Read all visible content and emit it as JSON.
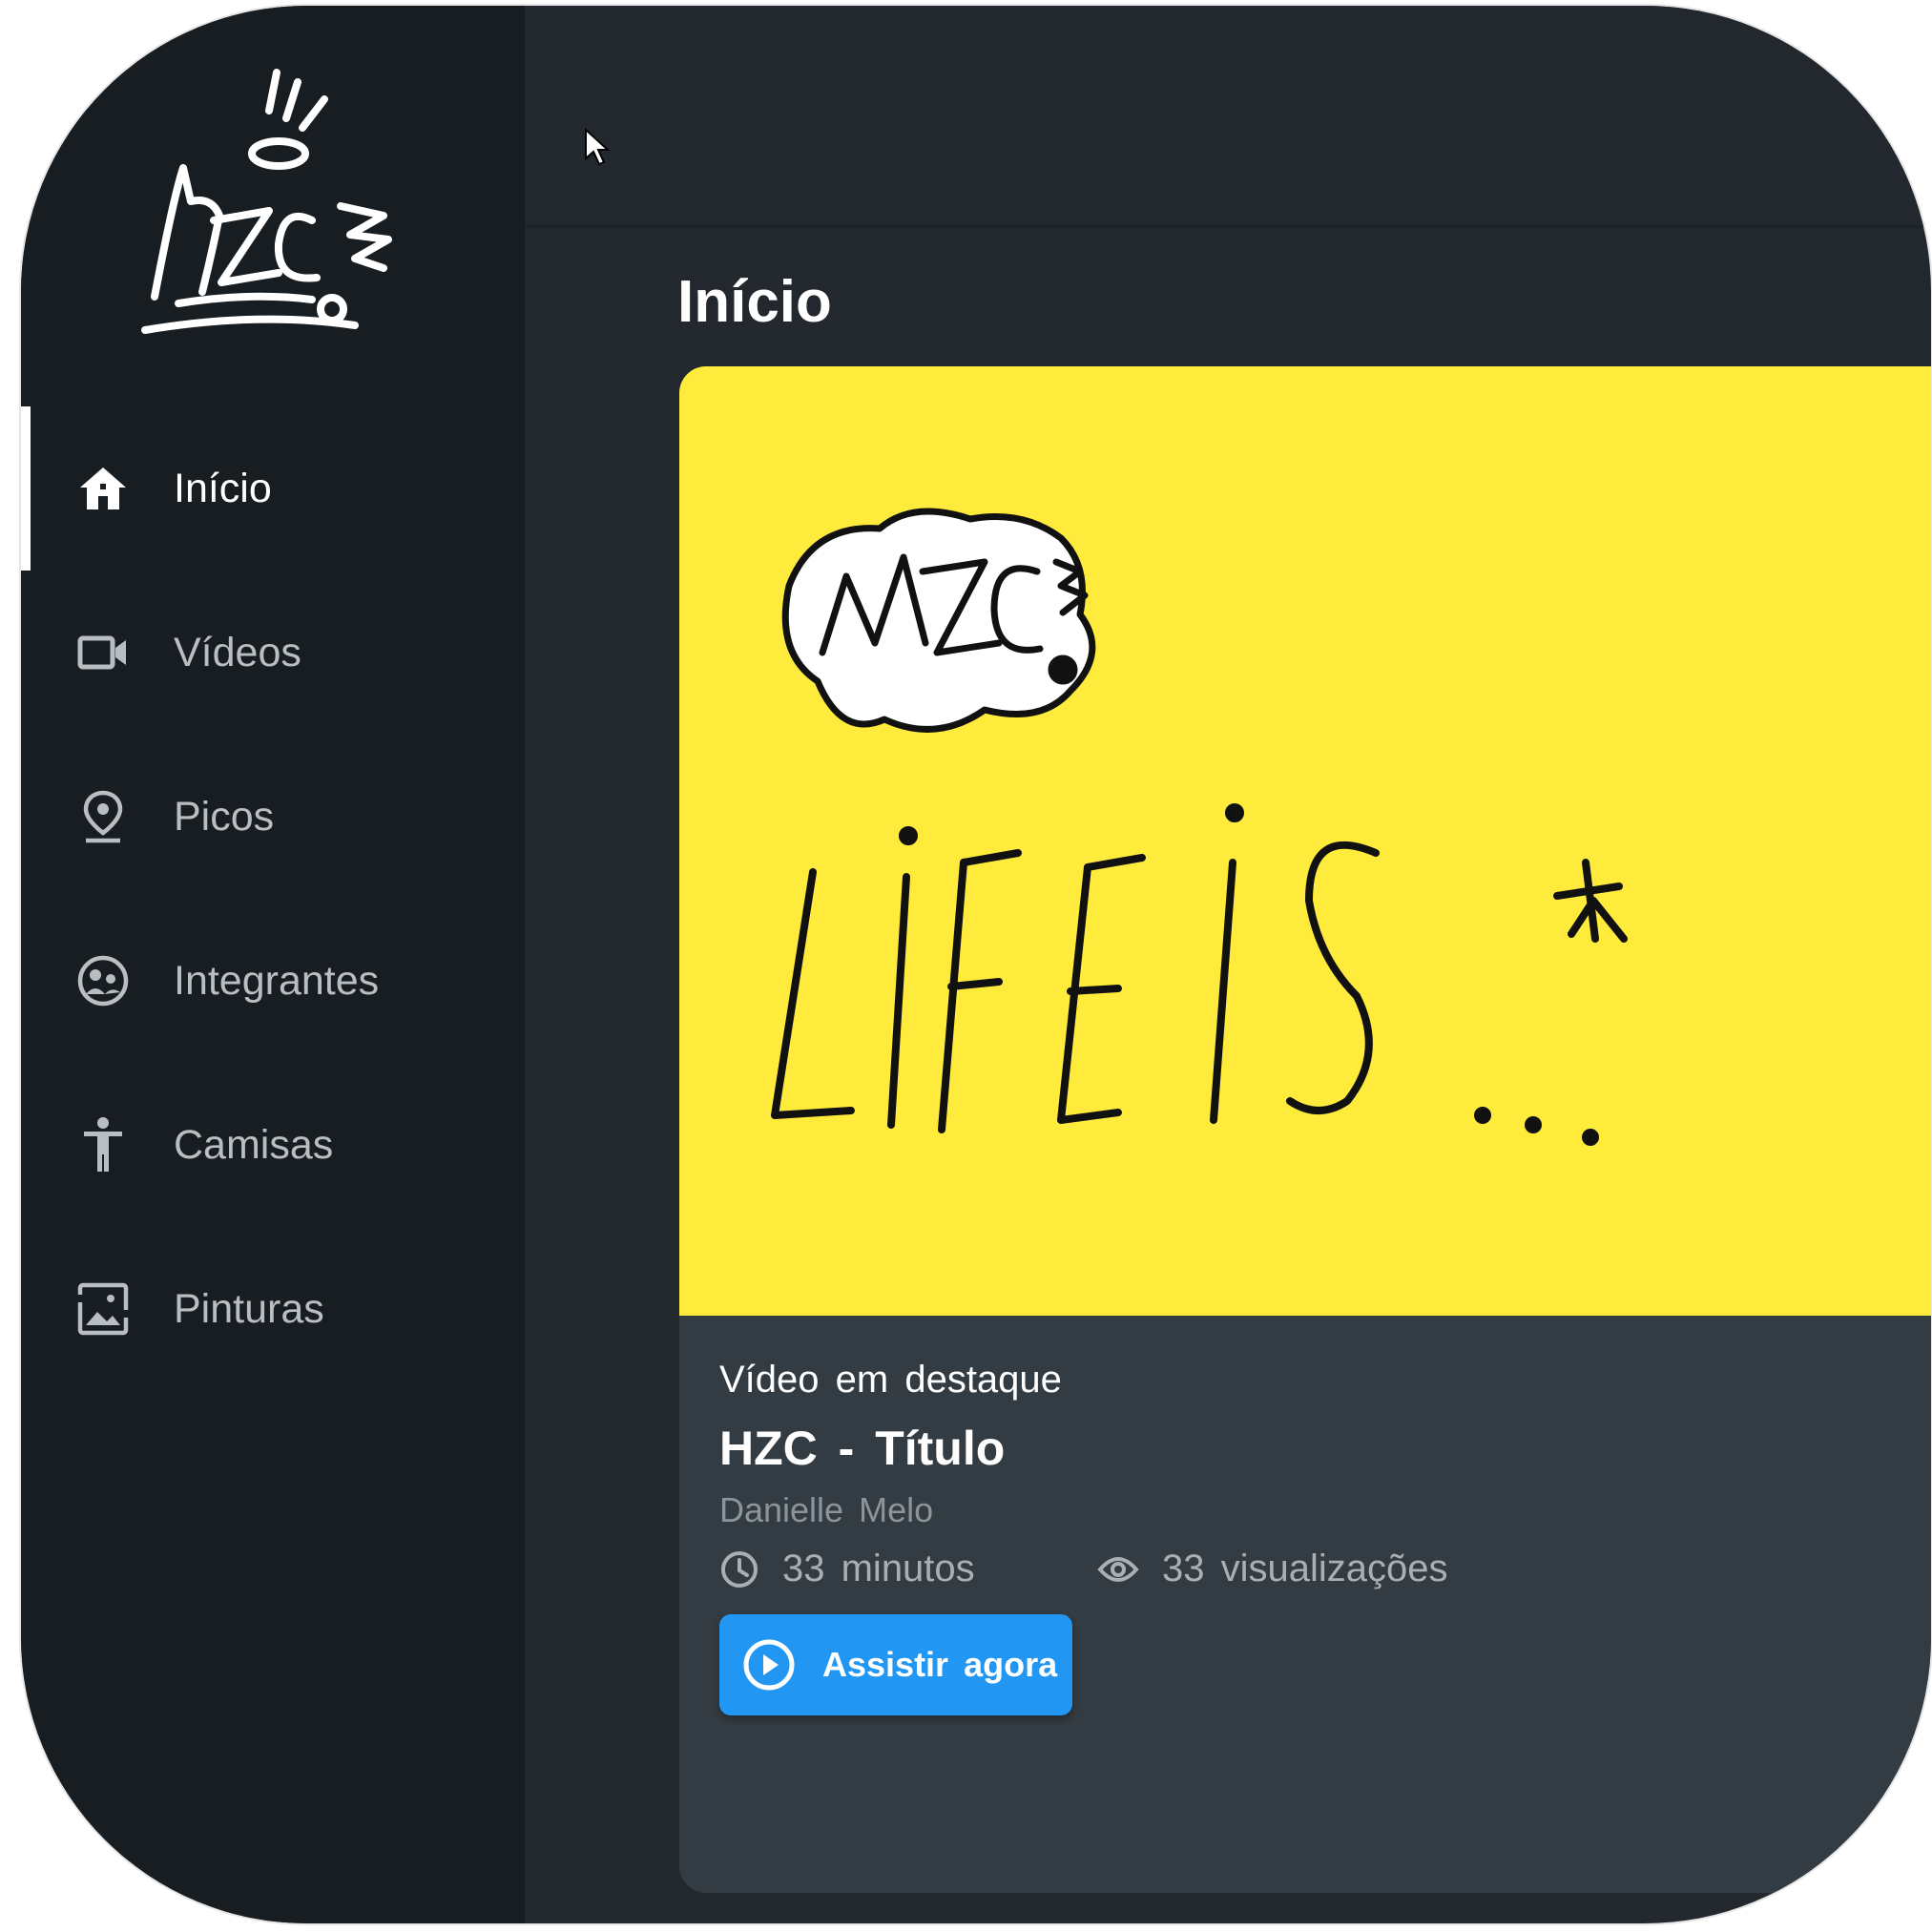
{
  "app": {
    "brand_logo": "HZC graffiti logo",
    "colors": {
      "sidebar_bg": "#181d21",
      "main_bg": "#22282d",
      "card_bg": "#333c42",
      "thumbnail_bg": "#ffeb3b",
      "accent": "#2196f3"
    }
  },
  "sidebar": {
    "items": [
      {
        "label": "Início",
        "icon": "home-icon",
        "active": true
      },
      {
        "label": "Vídeos",
        "icon": "video-camera-icon",
        "active": false
      },
      {
        "label": "Picos",
        "icon": "location-pin-icon",
        "active": false
      },
      {
        "label": "Integrantes",
        "icon": "group-face-icon",
        "active": false
      },
      {
        "label": "Camisas",
        "icon": "person-icon",
        "active": false
      },
      {
        "label": "Pinturas",
        "icon": "image-icon",
        "active": false
      }
    ]
  },
  "main": {
    "page_title": "Início",
    "featured": {
      "thumbnail_logo_text": "HZC",
      "thumbnail_text": "LIFE IS ...",
      "label": "Vídeo em destaque",
      "title": "HZC - Título",
      "author": "Danielle Melo",
      "duration": "33 minutos",
      "views": "33 visualizações",
      "watch_button": "Assistir agora"
    }
  }
}
